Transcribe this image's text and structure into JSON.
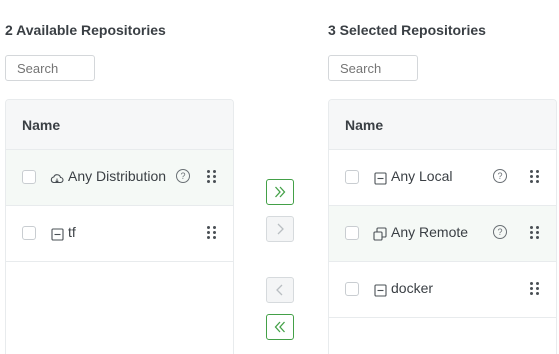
{
  "available": {
    "title": "2 Available Repositories",
    "search_placeholder": "Search",
    "column_name": "Name",
    "rows": [
      {
        "name": "Any Distribution",
        "icon": "cloud-distribution-icon",
        "help": "?"
      },
      {
        "name": "tf",
        "icon": "local-repo-icon"
      }
    ]
  },
  "selected": {
    "title": "3 Selected Repositories",
    "search_placeholder": "Search",
    "column_name": "Name",
    "rows": [
      {
        "name": "Any Local",
        "icon": "local-repo-icon",
        "help": "?"
      },
      {
        "name": "Any Remote",
        "icon": "remote-repo-icon",
        "help": "?"
      },
      {
        "name": "docker",
        "icon": "local-repo-icon"
      }
    ]
  },
  "colors": {
    "accent": "#43a047",
    "disabled": "#b9bec2",
    "row_highlight": "#f5f9f6"
  }
}
